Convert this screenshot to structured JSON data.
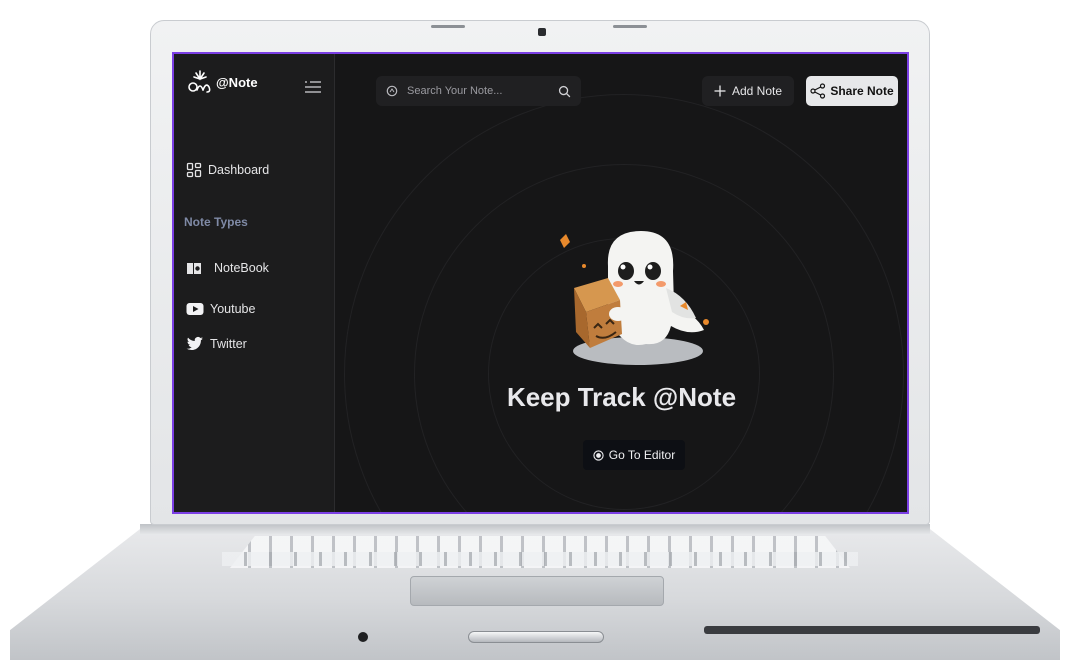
{
  "app": {
    "brand_name": "@Note",
    "accent_color": "#7b3fe4"
  },
  "sidebar": {
    "dashboard_label": "Dashboard",
    "section_title": "Note Types",
    "items": [
      {
        "label": "NoteBook",
        "icon": "notebook-icon"
      },
      {
        "label": "Youtube",
        "icon": "youtube-icon"
      },
      {
        "label": "Twitter",
        "icon": "twitter-icon"
      }
    ]
  },
  "topbar": {
    "search_placeholder": "Search Your Note...",
    "add_label": "Add Note",
    "share_label": "Share Note"
  },
  "hero": {
    "illustration": "ghost-with-box",
    "title": "Keep Track @Note",
    "cta_label": "Go To Editor"
  }
}
